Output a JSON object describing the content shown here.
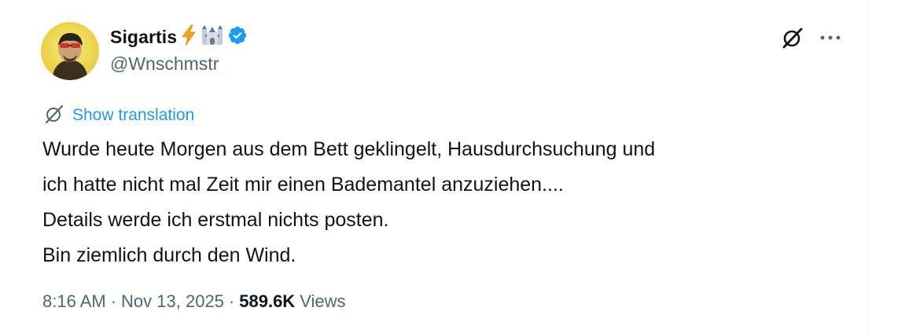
{
  "tweet": {
    "author": {
      "display_name": "Sigartis",
      "name_emojis": [
        "lightning-emoji",
        "castle-emoji"
      ],
      "verified": true,
      "handle": "@Wnschmstr"
    },
    "translate_label": "Show translation",
    "text_lines": [
      "Wurde heute Morgen aus dem Bett geklingelt, Hausdurchsuchung und",
      "ich hatte nicht mal Zeit mir einen Bademantel anzuziehen....",
      "Details werde ich erstmal nichts posten.",
      "Bin ziemlich durch den Wind."
    ],
    "meta": {
      "time": "8:16 AM",
      "separator": "·",
      "date": "Nov 13, 2025",
      "views_count": "589.6K",
      "views_label": "Views"
    },
    "icons": {
      "grok": "grok-icon",
      "more": "more-dots-icon",
      "translate": "translate-icon",
      "verified": "verified-badge-icon"
    },
    "colors": {
      "link_blue": "#1d9bf0",
      "secondary_text": "#536471",
      "primary_text": "#0f1419",
      "verified_blue": "#1d9bf0"
    }
  }
}
